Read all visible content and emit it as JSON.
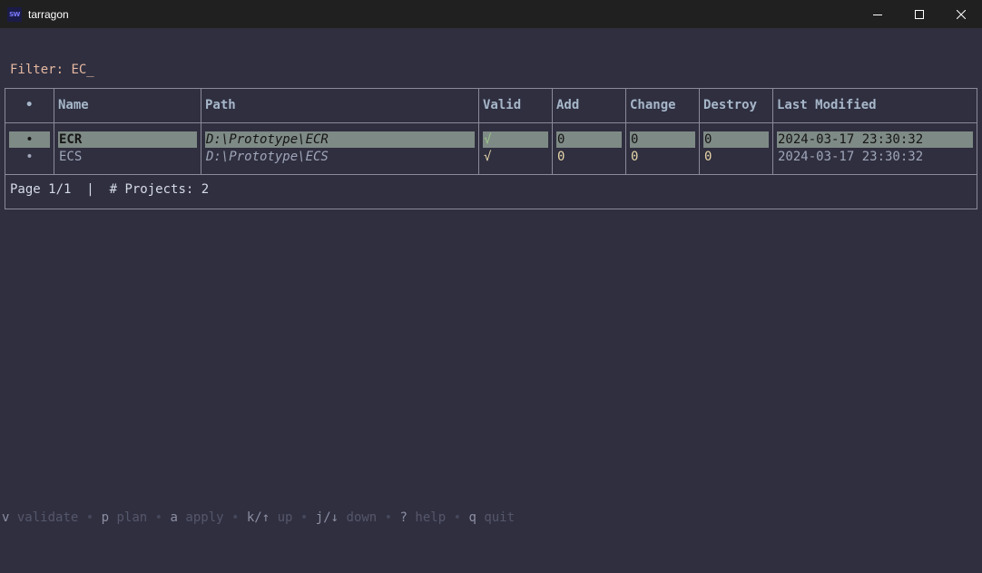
{
  "window": {
    "title": "tarragon",
    "icon": "app-icon",
    "icon_text": "SW"
  },
  "filter": {
    "label": "Filter:",
    "value": "EC_"
  },
  "table": {
    "headers": [
      "•",
      "Name",
      "Path",
      "Valid",
      "Add",
      "Change",
      "Destroy",
      "Last Modified"
    ],
    "rows": [
      {
        "bullet": "•",
        "name": "ECR",
        "path": "D:\\Prototype\\ECR",
        "valid": "√",
        "add": "0",
        "change": "0",
        "destroy": "0",
        "last_modified": "2024-03-17 23:30:32",
        "selected": true
      },
      {
        "bullet": "•",
        "name": "ECS",
        "path": "D:\\Prototype\\ECS",
        "valid": "√",
        "add": "0",
        "change": "0",
        "destroy": "0",
        "last_modified": "2024-03-17 23:30:32",
        "selected": false
      }
    ]
  },
  "footer": {
    "page": "Page 1/1",
    "separator": "|",
    "projects": "# Projects: 2"
  },
  "keybindings": [
    {
      "key": "v",
      "label": "validate"
    },
    {
      "key": "p",
      "label": "plan"
    },
    {
      "key": "a",
      "label": "apply"
    },
    {
      "key": "k/↑",
      "label": "up"
    },
    {
      "key": "j/↓",
      "label": "down"
    },
    {
      "key": "?",
      "label": "help"
    },
    {
      "key": "q",
      "label": "quit"
    }
  ],
  "keybinding_separator": "•",
  "colors": {
    "background": "#2f2f40",
    "titlebar": "#202020",
    "border": "#8a8a9a",
    "header_text": "#a6b7c9",
    "filter_text": "#e6b8a0",
    "selected_row": "#7e8a85",
    "valid_check": "#9bc58b"
  }
}
